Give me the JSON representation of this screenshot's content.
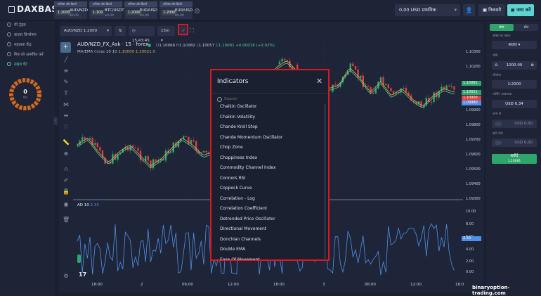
{
  "brand": {
    "logo": "DAXBASE"
  },
  "asset_tabs": [
    {
      "header": "फॉरेक्स और क्रिप्टो",
      "pct": "1:2000",
      "name": "AUD/NZD",
      "amount": "$0,00"
    },
    {
      "header": "फॉरेक्स और क्रिप्टो",
      "pct": "1:100",
      "name": "BTC/USDT",
      "amount": "$0,00"
    },
    {
      "header": "फॉरेक्स और क्रिप्टो",
      "pct": "1:2000",
      "name": "EUR/USD",
      "amount": "$0,00"
    },
    {
      "header": "फॉरेक्स और क्रिप्टो",
      "pct": "1:2000",
      "name": "EUR/USD",
      "amount": "$0,00"
    }
  ],
  "header": {
    "balance": "0,00 USD प्राथमिक",
    "withdraw": "निकासी",
    "deposit": "जमा करें"
  },
  "sidebar": {
    "items": [
      {
        "label": "मेरे ट्रेड्स"
      },
      {
        "label": "बाजार विश्लेषण"
      },
      {
        "label": "सहायता केंद्र"
      },
      {
        "label": "मित्र को आमंत्रित करें"
      },
      {
        "label": "लाइव चैट"
      }
    ],
    "donut_value": "0",
    "donut_sub": "दिन"
  },
  "chart_toolbar": {
    "pair": "AUD/NZD 1:2000",
    "time": "15:43:45",
    "interval": "15m"
  },
  "chart_header": {
    "symbol": "AUD/NZD_FX_Ask · 15 · forex",
    "o_label": "O",
    "o": "1.10066",
    "h_label": "H",
    "h": "1.10082",
    "l_label": "L",
    "l": "1.10057",
    "c_label": "C",
    "c": "1.10081 +0.00018 (+0.02%)",
    "ma_label": "MA/EMA Cross 10 10",
    "ma_v1": "1.10000",
    "ma_v2": "1.10021",
    "ma_v3": "0"
  },
  "price_axis": {
    "ticks": [
      "1.10300",
      "1.10200",
      "1.10081",
      "1.10021",
      "1.10000",
      "1.09980",
      "1.09900",
      "1.09800",
      "1.09700",
      "1.09600",
      "1.09500",
      "1.09400",
      "1.09300"
    ],
    "tags": [
      {
        "value": "1.10081",
        "color": "#2fa56b"
      },
      {
        "value": "1.10021",
        "color": "#2fa56b"
      },
      {
        "value": "1.10000",
        "color": "#d94040"
      },
      {
        "value": "1.09980",
        "color": "#4f8fe8"
      }
    ]
  },
  "ad_panel": {
    "label": "AD 10",
    "value": "2.33",
    "ticks": [
      "10.00",
      "8.00",
      "6.00",
      "4.00",
      "2.00",
      "1.00",
      "0.00"
    ],
    "tag": "2.33"
  },
  "time_axis": [
    "18:00",
    "2",
    "06:00",
    "12:00",
    "18:00",
    "3",
    "06:00",
    "12:00",
    "18:0"
  ],
  "modal": {
    "title": "Indicators",
    "search_placeholder": "Search",
    "items": [
      "Chaikin Oscillator",
      "Chaikin Volatility",
      "Chande Kroll Stop",
      "Chande Momentum Oscillator",
      "Chop Zone",
      "Choppiness Index",
      "Commodity Channel Index",
      "Connors RSI",
      "Coppock Curve",
      "Correlation - Log",
      "Correlation Coefficient",
      "Detrended Price Oscillator",
      "Directional Movement",
      "Donchian Channels",
      "Double EMA",
      "Ease Of Movement"
    ]
  },
  "right_panel": {
    "tab_buy": "बाय",
    "tab_sell": "सेल",
    "order_type_label": "ऑर्डर का प्रकार",
    "order_type": "बाजार",
    "amount_label": "राशि",
    "amount": "1000.00",
    "leverage_label": "लीवरेज",
    "leverage": "1:2000",
    "margin_label": "मार्जिन आवश्यक",
    "margin": "USD 0,34",
    "tp_label": "लाभ लें",
    "tp": "USD 0,00",
    "sl_label": "क्षति रोकें",
    "sl": "USD 0,00",
    "action": "खरीदें",
    "action_sub": "1,10081"
  },
  "watermark": "binaryoption-trading.com"
}
